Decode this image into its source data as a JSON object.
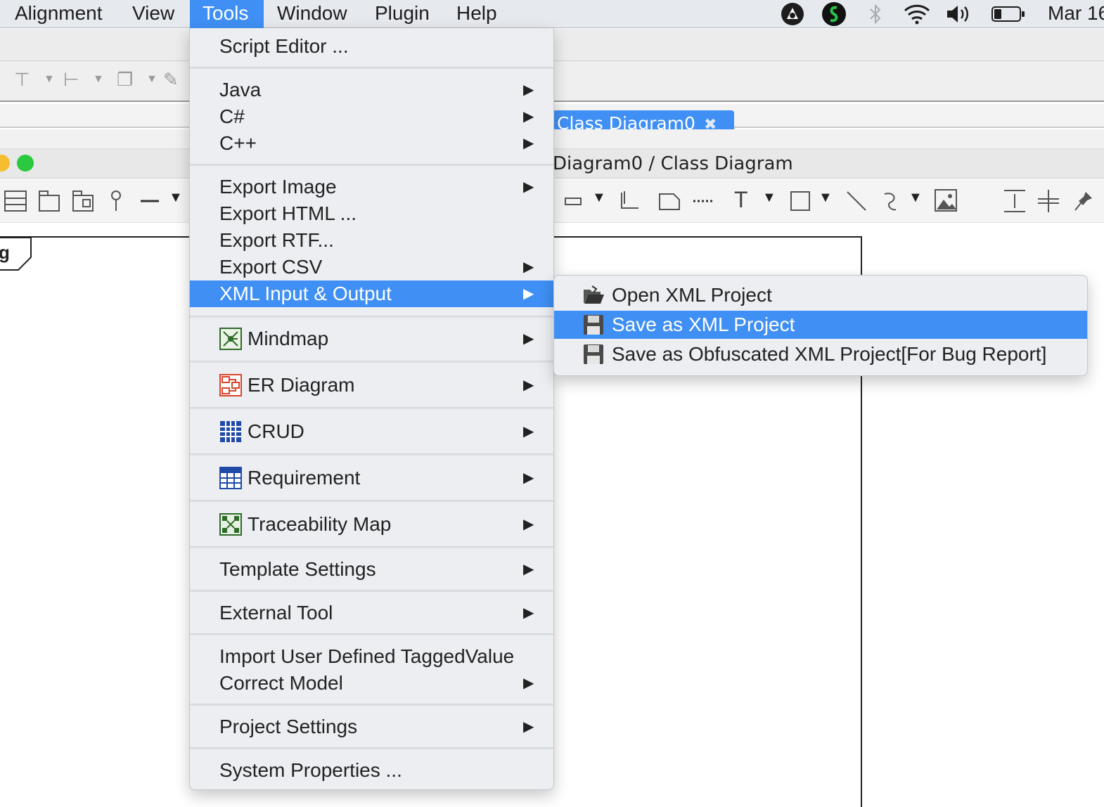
{
  "menubar": {
    "items": [
      {
        "label": "Alignment"
      },
      {
        "label": "View"
      },
      {
        "label": "Tools"
      },
      {
        "label": "Window"
      },
      {
        "label": "Plugin"
      },
      {
        "label": "Help"
      }
    ],
    "clock": "Mar 16",
    "status_icons": [
      "app-icon",
      "app-icon-green",
      "bluetooth-icon",
      "wifi-icon",
      "volume-icon",
      "battery-icon"
    ]
  },
  "tab": {
    "label": "Class Diagram0",
    "close": "✖"
  },
  "window": {
    "title": "Diagram0 / Class Diagram"
  },
  "canvas": {
    "frame_tag": "g"
  },
  "tools_menu": {
    "items": [
      {
        "label": "Script Editor ..."
      },
      {
        "label": "Java",
        "submenu": true
      },
      {
        "label": "C#",
        "submenu": true
      },
      {
        "label": "C++",
        "submenu": true
      },
      {
        "label": "Export Image",
        "submenu": true
      },
      {
        "label": "Export HTML ..."
      },
      {
        "label": "Export RTF..."
      },
      {
        "label": "Export CSV",
        "submenu": true
      },
      {
        "label": "XML Input & Output",
        "submenu": true,
        "highlighted": true
      },
      {
        "label": "Mindmap",
        "submenu": true,
        "icon": "mindmap-icon"
      },
      {
        "label": "ER Diagram",
        "submenu": true,
        "icon": "er-diagram-icon"
      },
      {
        "label": "CRUD",
        "submenu": true,
        "icon": "crud-icon"
      },
      {
        "label": "Requirement",
        "submenu": true,
        "icon": "requirement-icon"
      },
      {
        "label": "Traceability Map",
        "submenu": true,
        "icon": "traceability-map-icon"
      },
      {
        "label": "Template Settings",
        "submenu": true
      },
      {
        "label": "External Tool",
        "submenu": true
      },
      {
        "label": "Import User Defined TaggedValue"
      },
      {
        "label": "Correct Model",
        "submenu": true
      },
      {
        "label": "Project Settings",
        "submenu": true
      },
      {
        "label": "System Properties ..."
      }
    ],
    "arrow": "▶"
  },
  "xml_submenu": {
    "items": [
      {
        "label": "Open XML Project",
        "icon": "folder-open-icon"
      },
      {
        "label": "Save as XML Project",
        "icon": "floppy-disk-icon",
        "highlighted": true
      },
      {
        "label": "Save as Obfuscated XML Project[For Bug Report]",
        "icon": "floppy-disk-icon"
      }
    ]
  },
  "colors": {
    "accent": "#3f8ff4",
    "menu_bg": "#eceef2",
    "traffic_yellow": "#f6be2f",
    "traffic_green": "#2ac940"
  }
}
